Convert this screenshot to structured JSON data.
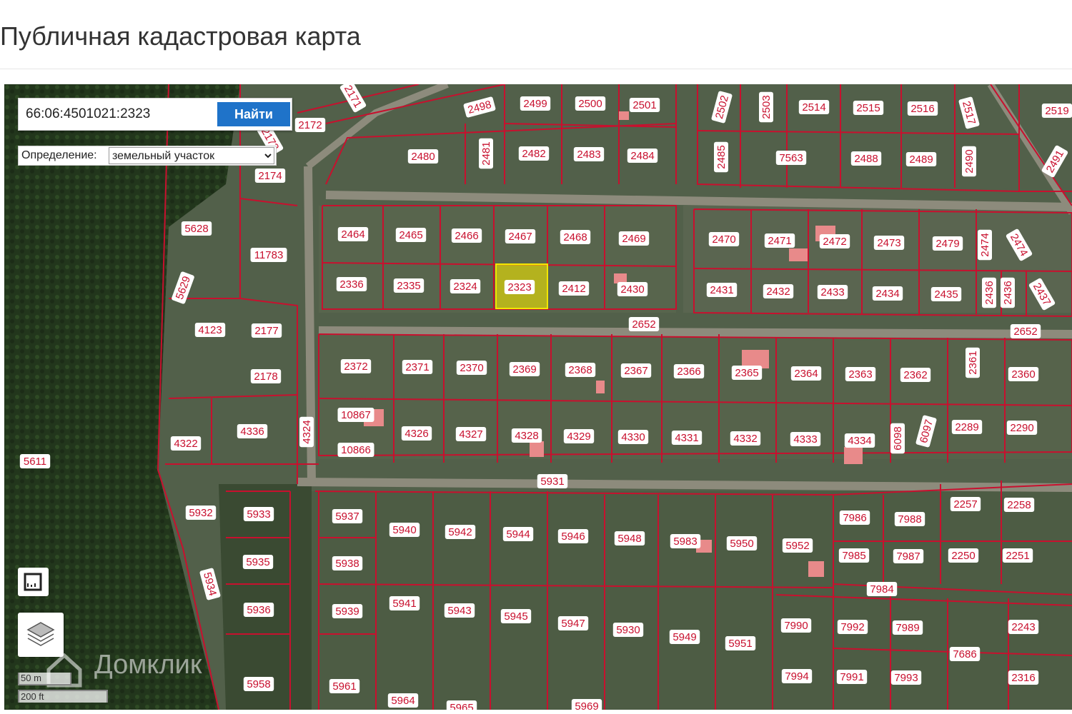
{
  "page": {
    "title": "Публичная кадастровая карта"
  },
  "search": {
    "value": "66:06:4501021:2323",
    "button_label": "Найти"
  },
  "definition": {
    "label": "Определение:",
    "selected": "земельный участок"
  },
  "scale": {
    "metric": "50 m",
    "imperial": "200 ft"
  },
  "watermark": {
    "text": "Домклик"
  },
  "colors": {
    "boundary": "#c8102e",
    "highlight": "#f2e600",
    "button": "#1f73c9",
    "label_text": "#c8102e"
  },
  "icons": [
    "ruler-icon",
    "layers-icon",
    "domclick-logo-icon"
  ],
  "map": {
    "selected_plot": "2323",
    "plots": [
      "2171",
      "2172",
      "2173",
      "2174",
      "2498",
      "2499",
      "2500",
      "2501",
      "2502",
      "2503",
      "2514",
      "2515",
      "2516",
      "2517",
      "2519",
      "2480",
      "2481",
      "2482",
      "2483",
      "2484",
      "2485",
      "7563",
      "2488",
      "2489",
      "2490",
      "2491",
      "5628",
      "11783",
      "2464",
      "2465",
      "2466",
      "2467",
      "2468",
      "2469",
      "2470",
      "2471",
      "2472",
      "2473",
      "2479",
      "2474",
      "2474",
      "5629",
      "2336",
      "2335",
      "2324",
      "2323",
      "2412",
      "2430",
      "2431",
      "2432",
      "2433",
      "2434",
      "2435",
      "2436",
      "2436",
      "2437",
      "4123",
      "2177",
      "2652",
      "2652",
      "2178",
      "2372",
      "2371",
      "2370",
      "2369",
      "2368",
      "2367",
      "2366",
      "2365",
      "2364",
      "2363",
      "2362",
      "2361",
      "2360",
      "10867",
      "10866",
      "4324",
      "4336",
      "4322",
      "5611",
      "4326",
      "4327",
      "4328",
      "4329",
      "4330",
      "4331",
      "4332",
      "4333",
      "4334",
      "6098",
      "6097",
      "2289",
      "2290",
      "5931",
      "5932",
      "5933",
      "5937",
      "5940",
      "5942",
      "5944",
      "5946",
      "5948",
      "5983",
      "5950",
      "5952",
      "7986",
      "7988",
      "2257",
      "2258",
      "5938",
      "7985",
      "7987",
      "2250",
      "2251",
      "7984",
      "5935",
      "5934",
      "5936",
      "5939",
      "5941",
      "5943",
      "5945",
      "5947",
      "5930",
      "5949",
      "5951",
      "7990",
      "7992",
      "7989",
      "2243",
      "7686",
      "5958",
      "5961",
      "5964",
      "5965",
      "5969",
      "7994",
      "7991",
      "7993",
      "2316"
    ]
  }
}
